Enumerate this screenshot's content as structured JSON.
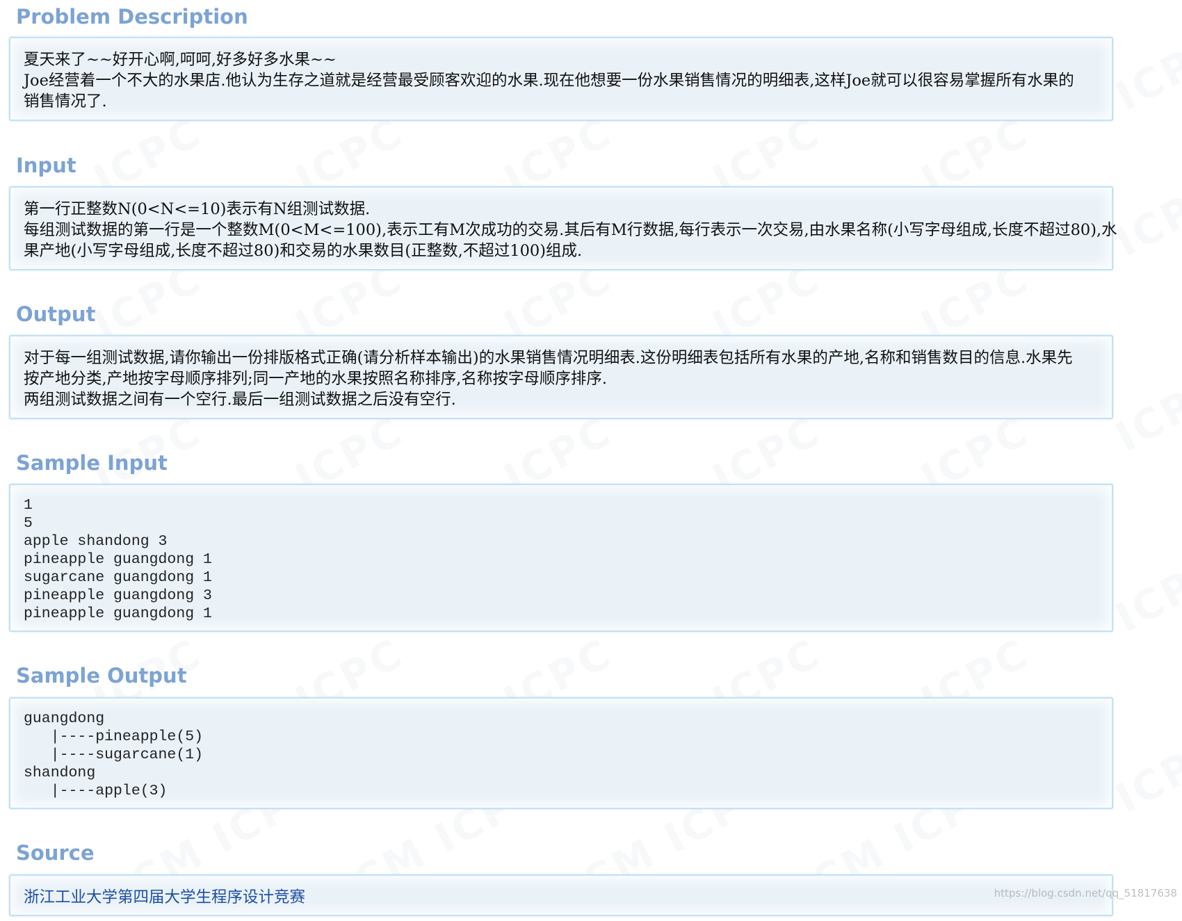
{
  "sections": {
    "description": {
      "title": "Problem Description",
      "lines": [
        "夏天来了~~好开心啊,呵呵,好多好多水果~~",
        "Joe经营着一个不大的水果店.他认为生存之道就是经营最受顾客欢迎的水果.现在他想要一份水果销售情况的明细表,这样Joe就可以很容易掌握所有水果的",
        "销售情况了."
      ]
    },
    "input": {
      "title": "Input",
      "lines": [
        "第一行正整数N(0<N<=10)表示有N组测试数据.",
        "每组测试数据的第一行是一个整数M(0<M<=100),表示工有M次成功的交易.其后有M行数据,每行表示一次交易,由水果名称(小写字母组成,长度不超过80),水",
        "果产地(小写字母组成,长度不超过80)和交易的水果数目(正整数,不超过100)组成."
      ]
    },
    "output": {
      "title": "Output",
      "lines": [
        "对于每一组测试数据,请你输出一份排版格式正确(请分析样本输出)的水果销售情况明细表.这份明细表包括所有水果的产地,名称和销售数目的信息.水果先",
        "按产地分类,产地按字母顺序排列;同一产地的水果按照名称排序,名称按字母顺序排序.",
        "两组测试数据之间有一个空行.最后一组测试数据之后没有空行."
      ]
    },
    "sample_input": {
      "title": "Sample Input",
      "lines": [
        "1",
        "5",
        "apple shandong 3",
        "pineapple guangdong 1",
        "sugarcane guangdong 1",
        "pineapple guangdong 3",
        "pineapple guangdong 1"
      ]
    },
    "sample_output": {
      "title": "Sample Output",
      "lines": [
        "guangdong",
        "   |----pineapple(5)",
        "   |----sugarcane(1)",
        "shandong",
        "   |----apple(3)"
      ]
    },
    "source": {
      "title": "Source",
      "link_text": "浙江工业大学第四届大学生程序设计竞赛"
    }
  },
  "footer": {
    "credit": "https://blog.csdn.net/qq_51817638"
  },
  "colors": {
    "heading": "#7ca3d4",
    "panel_bg": "#eaf2f8",
    "panel_border": "#c2e2f5",
    "link": "#1f4fa3"
  }
}
